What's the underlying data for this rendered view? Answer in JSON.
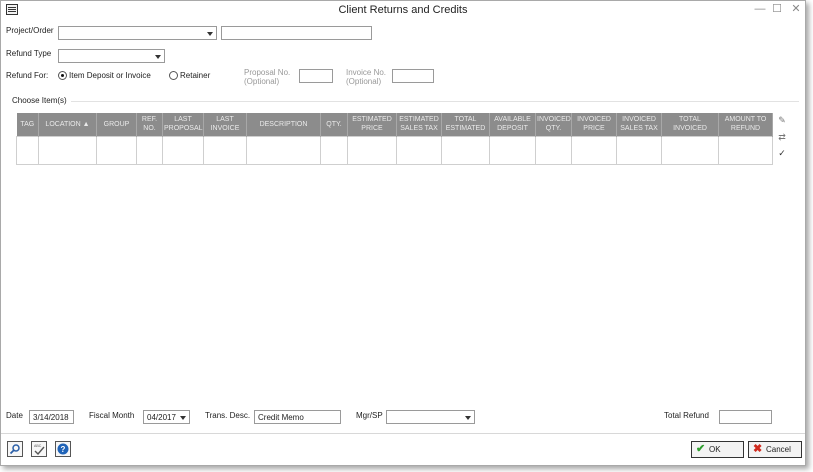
{
  "window": {
    "title": "Client Returns and Credits"
  },
  "window_controls": {
    "minimize": "—",
    "maximize": "☐",
    "close": "✕"
  },
  "form": {
    "project_order_label": "Project/Order",
    "refund_type_label": "Refund Type",
    "refund_for_label": "Refund For:",
    "radio_item_deposit": "Item Deposit or Invoice",
    "radio_retainer": "Retainer",
    "refund_for_selected": "Item Deposit or Invoice",
    "proposal_no_label": "Proposal No.",
    "proposal_no_optional": "(Optional)",
    "invoice_no_label": "Invoice No.",
    "invoice_no_optional": "(Optional)",
    "choose_items_label": "Choose Item(s)"
  },
  "grid": {
    "columns": [
      [
        "TAG"
      ],
      [
        "LOCATION ▲"
      ],
      [
        "GROUP"
      ],
      [
        "REF.",
        "NO."
      ],
      [
        "LAST",
        "PROPOSAL"
      ],
      [
        "LAST",
        "INVOICE"
      ],
      [
        "DESCRIPTION"
      ],
      [
        "QTY."
      ],
      [
        "ESTIMATED",
        "PRICE"
      ],
      [
        "ESTIMATED",
        "SALES TAX"
      ],
      [
        "TOTAL",
        "ESTIMATED"
      ],
      [
        "AVAILABLE",
        "DEPOSIT"
      ],
      [
        "INVOICED",
        "QTY."
      ],
      [
        "INVOICED",
        "PRICE"
      ],
      [
        "INVOICED",
        "SALES TAX"
      ],
      [
        "TOTAL",
        "INVOICED"
      ],
      [
        "AMOUNT TO",
        "REFUND"
      ]
    ],
    "rows": [
      [
        "",
        "",
        "",
        "",
        "",
        "",
        "",
        "",
        "",
        "",
        "",
        "",
        "",
        "",
        "",
        "",
        ""
      ]
    ]
  },
  "footer": {
    "date_label": "Date",
    "date_value": "3/14/2018",
    "fiscal_month_label": "Fiscal Month",
    "fiscal_month_value": "04/2017",
    "trans_desc_label": "Trans. Desc.",
    "trans_desc_value": "Credit Memo",
    "mgr_sp_label": "Mgr/SP",
    "total_refund_label": "Total Refund",
    "total_refund_value": ""
  },
  "buttons": {
    "ok": "OK",
    "cancel": "Cancel"
  },
  "icons": {
    "ok": "✔",
    "cancel": "✖",
    "row_edit": "✎",
    "row_copy": "⇄",
    "row_check": "✓"
  }
}
